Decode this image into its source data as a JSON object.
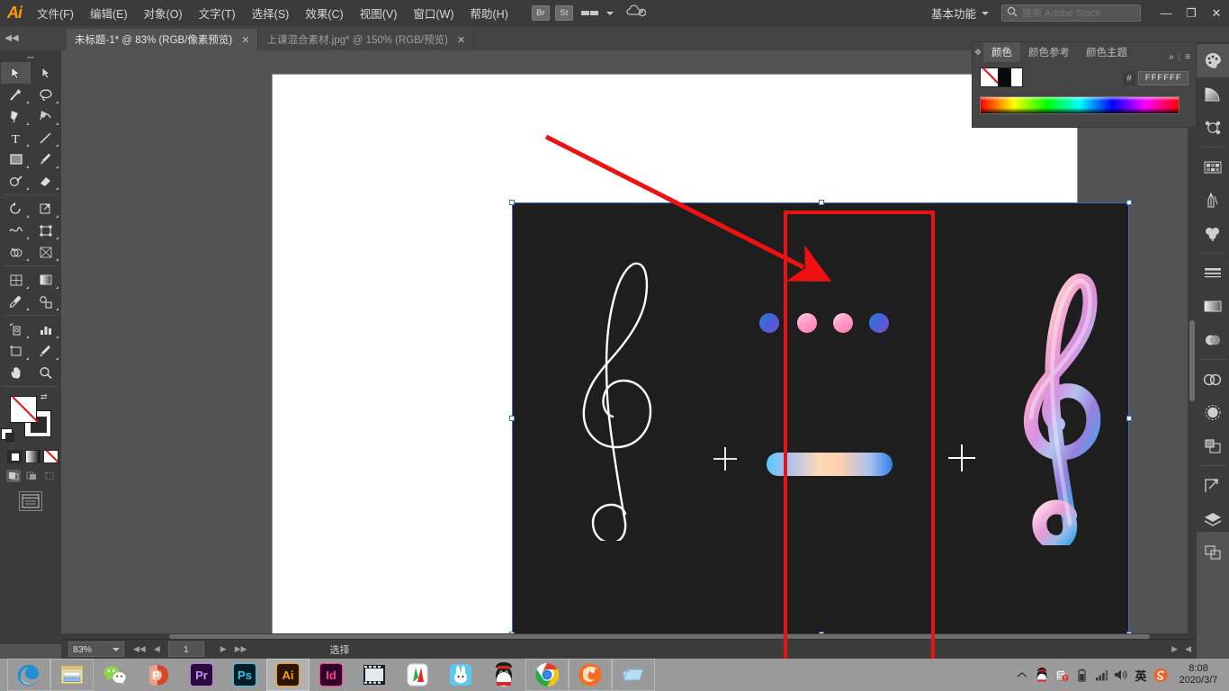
{
  "app": {
    "name": "Adobe Illustrator",
    "logo": "Ai",
    "workspace": "基本功能",
    "menus": [
      {
        "label": "文件(F)"
      },
      {
        "label": "编辑(E)"
      },
      {
        "label": "对象(O)"
      },
      {
        "label": "文字(T)"
      },
      {
        "label": "选择(S)"
      },
      {
        "label": "效果(C)"
      },
      {
        "label": "视图(V)"
      },
      {
        "label": "窗口(W)"
      },
      {
        "label": "帮助(H)"
      }
    ],
    "bridge_button": "Br",
    "stock_button": "St",
    "search": {
      "placeholder": "搜索 Adobe Stock",
      "value": ""
    },
    "window_controls": {
      "minimize": "—",
      "restore": "❐",
      "close": "✕"
    }
  },
  "tabs": [
    {
      "title": "未标题-1* @ 83% (RGB/像素预览)",
      "close": "✕",
      "active": true
    },
    {
      "title": "上课混合素材.jpg* @ 150% (RGB/预览)",
      "close": "✕",
      "active": false
    }
  ],
  "toolbar": {
    "collapse": "◀◀",
    "tools": [
      {
        "name": "selection-tool",
        "selected": true
      },
      {
        "name": "direct-selection-tool",
        "selected": false
      },
      {
        "name": "magic-wand-tool",
        "selected": false
      },
      {
        "name": "lasso-tool",
        "selected": false
      },
      {
        "name": "pen-tool",
        "selected": false
      },
      {
        "name": "curvature-tool",
        "selected": false
      },
      {
        "name": "type-tool",
        "selected": false
      },
      {
        "name": "line-segment-tool",
        "selected": false
      },
      {
        "name": "rectangle-tool",
        "selected": false
      },
      {
        "name": "paintbrush-tool",
        "selected": false
      },
      {
        "name": "shaper-tool",
        "selected": false
      },
      {
        "name": "eraser-tool",
        "selected": false
      },
      {
        "name": "rotate-tool",
        "selected": false
      },
      {
        "name": "scale-tool",
        "selected": false
      },
      {
        "name": "width-tool",
        "selected": false
      },
      {
        "name": "free-transform-tool",
        "selected": false
      },
      {
        "name": "shape-builder-tool",
        "selected": false
      },
      {
        "name": "perspective-grid-tool",
        "selected": false
      },
      {
        "name": "mesh-tool",
        "selected": false
      },
      {
        "name": "gradient-tool",
        "selected": false
      },
      {
        "name": "eyedropper-tool",
        "selected": false
      },
      {
        "name": "blend-tool",
        "selected": false
      },
      {
        "name": "symbol-sprayer-tool",
        "selected": false
      },
      {
        "name": "column-graph-tool",
        "selected": false
      },
      {
        "name": "artboard-tool",
        "selected": false
      },
      {
        "name": "slice-tool",
        "selected": false
      },
      {
        "name": "hand-tool",
        "selected": false
      },
      {
        "name": "zoom-tool",
        "selected": false
      }
    ],
    "swap_icon": "⇄",
    "fill_mode": "none",
    "color_modes": [
      "color",
      "gradient",
      "none"
    ],
    "screen_mode": "screen-mode"
  },
  "color_panel": {
    "tabs": [
      {
        "label": "颜色",
        "active": true
      },
      {
        "label": "颜色参考",
        "active": false
      },
      {
        "label": "颜色主题",
        "active": false
      }
    ],
    "collapse_icon": "»",
    "menu_icon": "≡",
    "hash": "#",
    "hex": "FFFFFF"
  },
  "right_dock": [
    {
      "name": "color-panel-icon",
      "selected": true
    },
    {
      "name": "gradient-panel-icon",
      "selected": false
    },
    {
      "name": "color-guide-panel-icon",
      "selected": false
    },
    {
      "name": "swatches-panel-icon",
      "selected": false
    },
    {
      "name": "brushes-panel-icon",
      "selected": false
    },
    {
      "name": "symbols-panel-icon",
      "selected": false
    },
    {
      "name": "stroke-panel-icon",
      "selected": false
    },
    {
      "name": "gradient-bar-panel-icon",
      "selected": false
    },
    {
      "name": "transparency-panel-icon",
      "selected": false
    },
    {
      "name": "creative-cloud-libraries-icon",
      "selected": false
    },
    {
      "name": "appearance-panel-icon",
      "selected": false
    },
    {
      "name": "pathfinder-panel-icon",
      "selected": false
    },
    {
      "name": "transform-panel-icon",
      "selected": false
    },
    {
      "name": "layers-panel-icon",
      "selected": false
    },
    {
      "name": "align-panel-icon",
      "selected": false
    }
  ],
  "canvas": {
    "artboard_background": "#ffffff",
    "dark_rect_color": "#1e1e1e",
    "selection_color": "#3a6ec4",
    "objects": [
      {
        "name": "white-line-treble-clef",
        "style": "white 2px stroke line art"
      },
      {
        "name": "gradient-treble-clef",
        "style": "pink purple blue 3d gradient"
      },
      {
        "name": "blend-dot-1",
        "color": "#2e7fe0"
      },
      {
        "name": "blend-dot-2",
        "color": "#ff9cc8"
      },
      {
        "name": "blend-dot-3",
        "color": "#ff9cc8"
      },
      {
        "name": "blend-dot-4",
        "color": "#2e7fe0"
      },
      {
        "name": "gradient-pill",
        "colors": [
          "#5bc8ff",
          "#ffd9b6",
          "#2f7fe8"
        ]
      },
      {
        "name": "plus-sign-left",
        "label": "+"
      },
      {
        "name": "plus-sign-right",
        "label": "+"
      }
    ],
    "annotations": {
      "arrow_color": "#ee1111",
      "box_color": "#ee1111"
    }
  },
  "statusbar": {
    "zoom": "83%",
    "page": "1",
    "status_text": "选择",
    "first_icon": "◀◀",
    "prev_icon": "◀",
    "next_icon": "▶",
    "last_icon": "▶▶",
    "right_next": "▶",
    "right_prev": "◀"
  },
  "taskbar": {
    "apps": [
      {
        "name": "edge-browser",
        "label": ""
      },
      {
        "name": "file-explorer",
        "label": ""
      },
      {
        "name": "wechat",
        "label": ""
      },
      {
        "name": "powerpoint",
        "label": "P"
      },
      {
        "name": "premiere-pro",
        "label": "Pr"
      },
      {
        "name": "photoshop",
        "label": "Ps"
      },
      {
        "name": "illustrator",
        "label": "Ai",
        "active": true
      },
      {
        "name": "indesign",
        "label": "Id"
      },
      {
        "name": "video-editor",
        "label": ""
      },
      {
        "name": "wps-office",
        "label": ""
      },
      {
        "name": "rabbit-app",
        "label": ""
      },
      {
        "name": "qq-messenger",
        "label": ""
      },
      {
        "name": "google-chrome",
        "label": ""
      },
      {
        "name": "firefox-browser",
        "label": ""
      },
      {
        "name": "explorer-window",
        "label": ""
      }
    ],
    "tray": [
      {
        "name": "show-hidden-icons",
        "glyph": "︿"
      },
      {
        "name": "qq-tray-icon",
        "glyph": ""
      },
      {
        "name": "security-tray-icon",
        "glyph": ""
      },
      {
        "name": "battery-tray-icon",
        "glyph": ""
      },
      {
        "name": "network-tray-icon",
        "glyph": ""
      },
      {
        "name": "volume-tray-icon",
        "glyph": ""
      },
      {
        "name": "ime-indicator",
        "glyph": "英"
      },
      {
        "name": "sogou-input-icon",
        "glyph": "S"
      }
    ],
    "clock": {
      "time": "8:08",
      "date": "2020/3/7"
    }
  }
}
